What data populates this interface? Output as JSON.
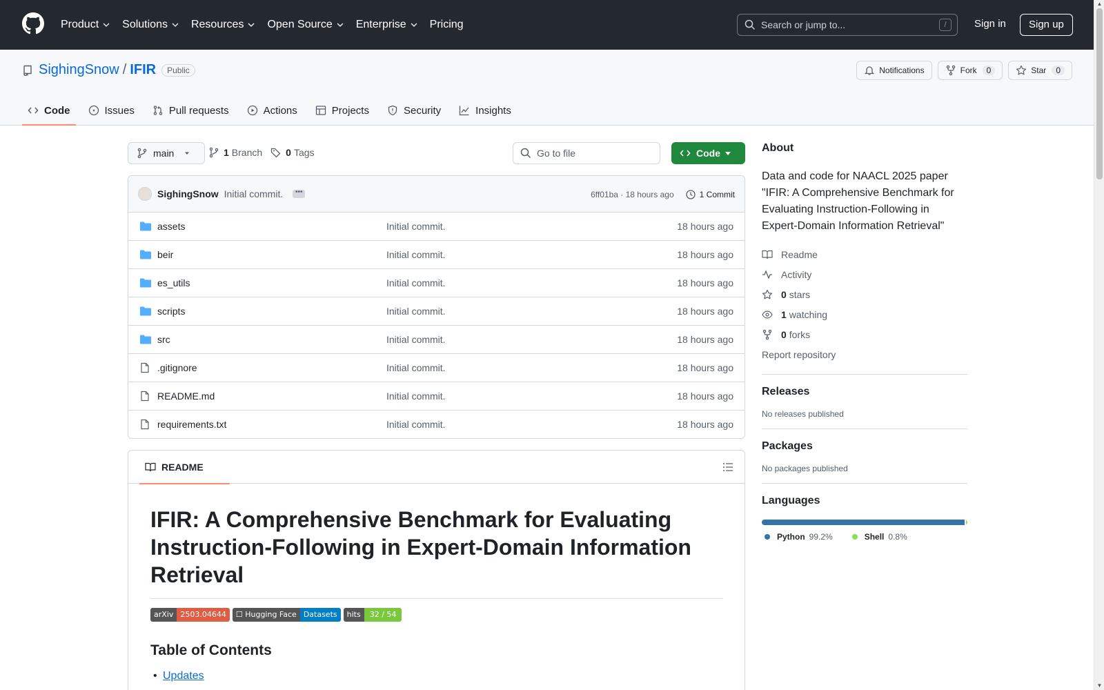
{
  "header": {
    "nav": [
      "Product",
      "Solutions",
      "Resources",
      "Open Source",
      "Enterprise"
    ],
    "pricing": "Pricing",
    "search_placeholder": "Search or jump to...",
    "search_key": "/",
    "signin": "Sign in",
    "signup": "Sign up"
  },
  "repo": {
    "owner": "SighingSnow",
    "sep": "/",
    "name": "IFIR",
    "visibility": "Public",
    "notifications": "Notifications",
    "fork_label": "Fork",
    "fork_count": "0",
    "star_label": "Star",
    "star_count": "0",
    "tabs": [
      "Code",
      "Issues",
      "Pull requests",
      "Actions",
      "Projects",
      "Security",
      "Insights"
    ]
  },
  "toolbar": {
    "branch": "main",
    "branch_count": "1",
    "branch_label": "Branch",
    "tag_count": "0",
    "tag_label": "Tags",
    "goto_placeholder": "Go to file",
    "code_label": "Code"
  },
  "commit": {
    "author": "SighingSnow",
    "message": "Initial commit.",
    "ellipsis": "•••",
    "sha_time": "6ff01ba · 18 hours ago",
    "commits": "1 Commit"
  },
  "files": [
    {
      "name": "assets",
      "type": "dir",
      "msg": "Initial commit.",
      "time": "18 hours ago"
    },
    {
      "name": "beir",
      "type": "dir",
      "msg": "Initial commit.",
      "time": "18 hours ago"
    },
    {
      "name": "es_utils",
      "type": "dir",
      "msg": "Initial commit.",
      "time": "18 hours ago"
    },
    {
      "name": "scripts",
      "type": "dir",
      "msg": "Initial commit.",
      "time": "18 hours ago"
    },
    {
      "name": "src",
      "type": "dir",
      "msg": "Initial commit.",
      "time": "18 hours ago"
    },
    {
      "name": ".gitignore",
      "type": "file",
      "msg": "Initial commit.",
      "time": "18 hours ago"
    },
    {
      "name": "README.md",
      "type": "file",
      "msg": "Initial commit.",
      "time": "18 hours ago"
    },
    {
      "name": "requirements.txt",
      "type": "file",
      "msg": "Initial commit.",
      "time": "18 hours ago"
    }
  ],
  "readme": {
    "tab": "README",
    "title": "IFIR: A Comprehensive Benchmark for Evaluating Instruction-Following in Expert-Domain Information Retrieval",
    "badges": {
      "arxiv_label": "arXiv",
      "arxiv_value": "2503.04644",
      "hf_label": "☐ Hugging Face",
      "hf_value": "Datasets",
      "hits_label": "hits",
      "hits_value": "32 / 54"
    },
    "toc_heading": "Table of Contents",
    "toc_first": "Updates"
  },
  "sidebar": {
    "about_heading": "About",
    "description": "Data and code for NAACL 2025 paper \"IFIR: A Comprehensive Benchmark for Evaluating Instruction-Following in Expert-Domain Information Retrieval\"",
    "readme": "Readme",
    "activity": "Activity",
    "stars_count": "0",
    "stars_label": "stars",
    "watching_count": "1",
    "watching_label": "watching",
    "forks_count": "0",
    "forks_label": "forks",
    "report": "Report repository",
    "releases_heading": "Releases",
    "releases_text": "No releases published",
    "packages_heading": "Packages",
    "packages_text": "No packages published",
    "languages_heading": "Languages",
    "languages": [
      {
        "name": "Python",
        "pct": "99.2%",
        "value": 99.2,
        "color": "#3572A5"
      },
      {
        "name": "Shell",
        "pct": "0.8%",
        "value": 0.8,
        "color": "#89e051"
      }
    ]
  },
  "colors": {
    "header_bg": "#24292f",
    "link": "#0969da",
    "code_button": "#1f883d",
    "active_tab_underline": "#fd8c73"
  }
}
